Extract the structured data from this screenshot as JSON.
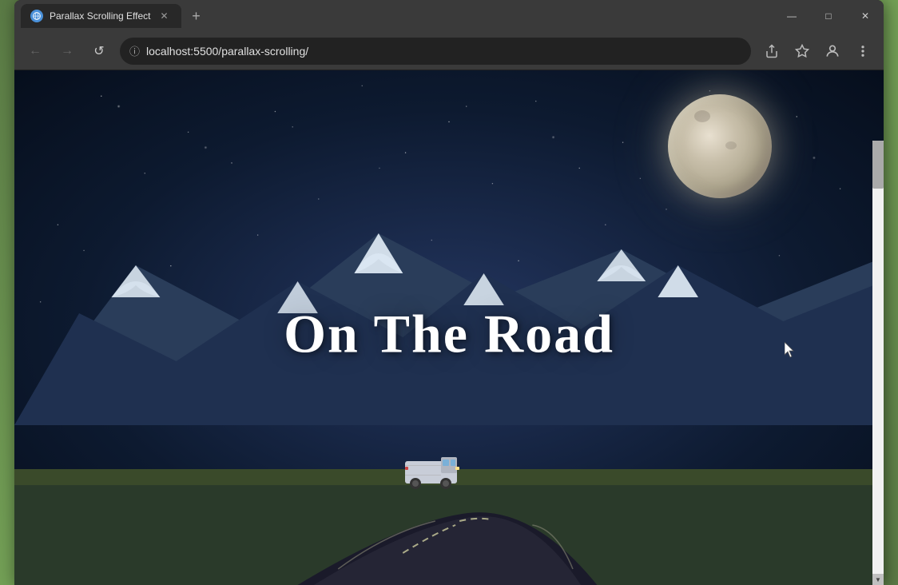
{
  "browser": {
    "tab": {
      "title": "Parallax Scrolling Effect",
      "favicon_label": "globe-icon"
    },
    "new_tab_label": "+",
    "nav": {
      "back_label": "←",
      "forward_label": "→",
      "reload_label": "↺",
      "url": "localhost:5500/parallax-scrolling/",
      "security_label": "ⓘ"
    },
    "actions": {
      "share_label": "⬆",
      "bookmark_label": "☆",
      "profile_label": "👤",
      "menu_label": "⋮"
    },
    "window_controls": {
      "minimize_label": "—",
      "maximize_label": "□",
      "close_label": "✕"
    }
  },
  "webpage": {
    "hero_text": "On The Road"
  },
  "colors": {
    "browser_bg": "#3a3a3a",
    "tab_bg": "#282828",
    "address_bg": "#222222",
    "scrollbar_track": "#f1f1f1",
    "scrollbar_thumb": "#aaaaaa"
  }
}
